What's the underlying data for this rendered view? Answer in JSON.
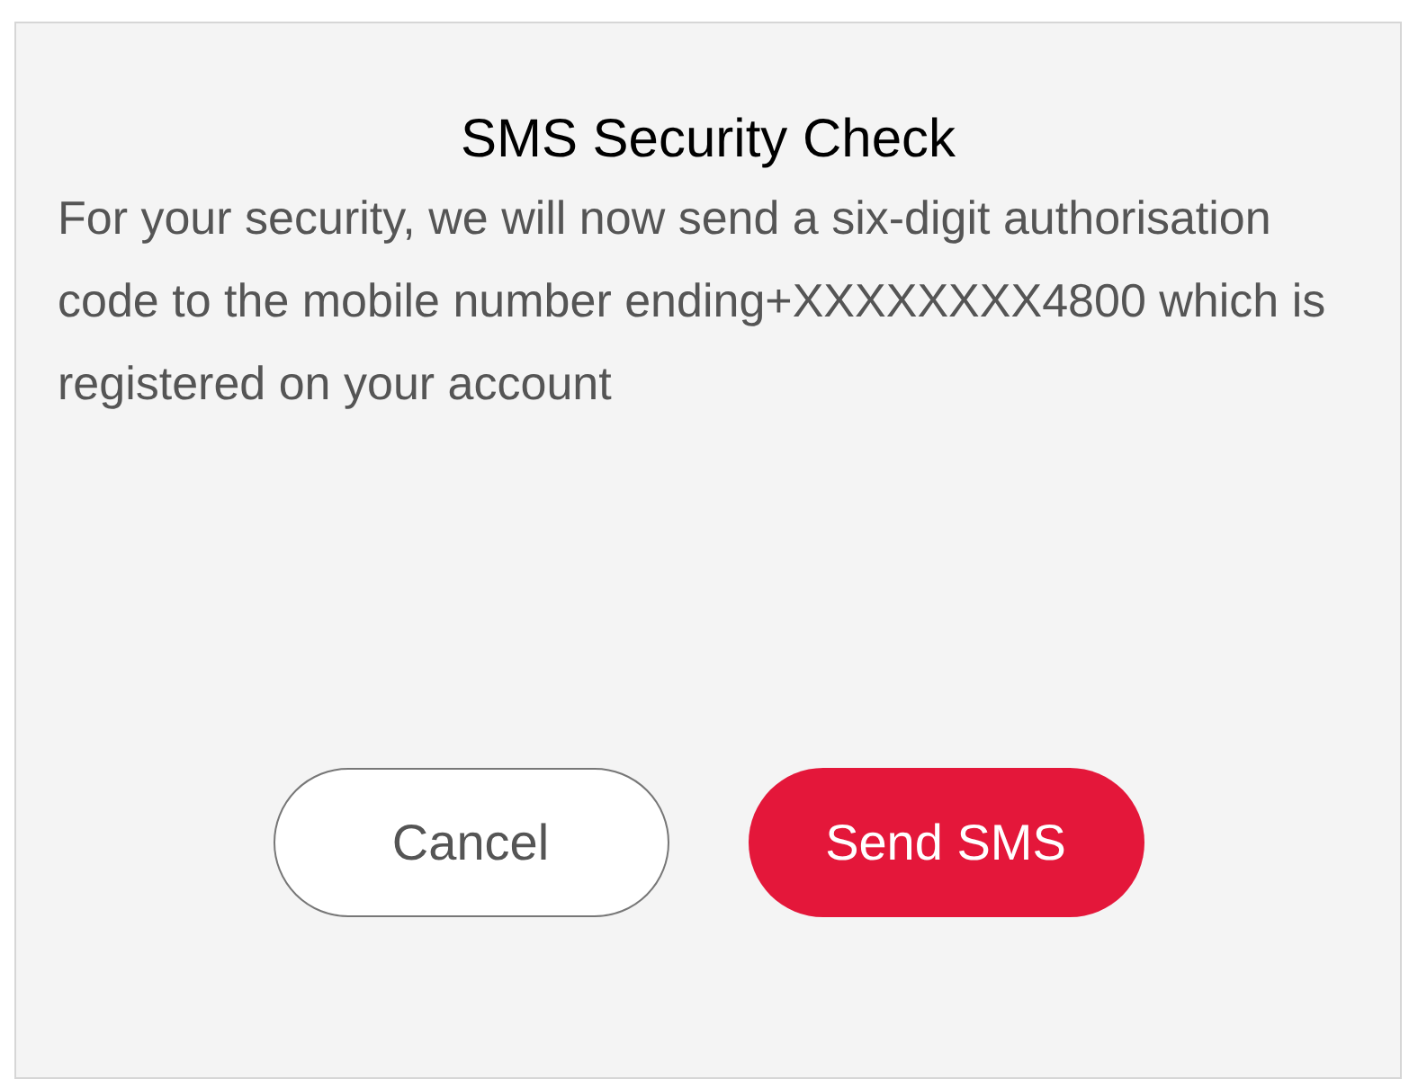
{
  "dialog": {
    "title": "SMS Security Check",
    "message": "For your security, we will now send a six-digit authorisation code to the mobile number ending+XXXXXXXX4800 which is registered on your account",
    "buttons": [
      {
        "label": "Cancel",
        "kind": "secondary"
      },
      {
        "label": "Send SMS",
        "kind": "primary"
      }
    ]
  }
}
